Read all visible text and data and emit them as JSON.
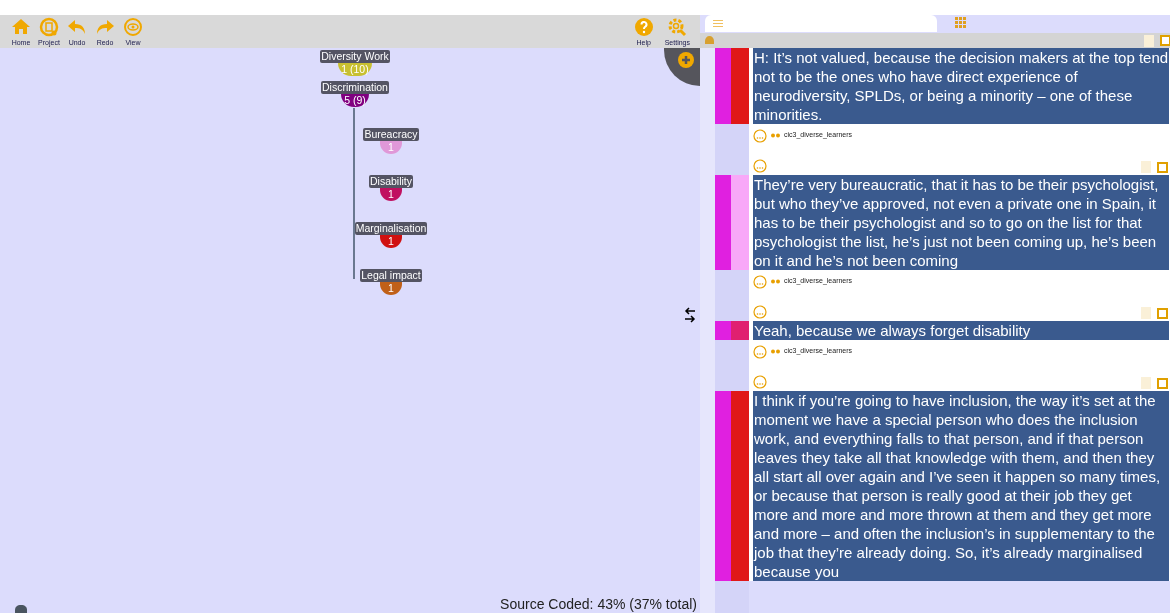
{
  "toolbar": {
    "left": [
      {
        "label": "Home"
      },
      {
        "label": "Project"
      },
      {
        "label": "Undo"
      },
      {
        "label": "Redo"
      },
      {
        "label": "View"
      }
    ],
    "right": [
      {
        "label": "Help"
      },
      {
        "label": "Settings"
      }
    ]
  },
  "tree": [
    {
      "label": "Diversity Work",
      "count": "1 (10)",
      "color": "#c8c030",
      "children": [
        {
          "label": "Discrimination",
          "count": "5 (9)",
          "color": "#800080",
          "children": [
            {
              "label": "Bureacracy",
              "count": "1",
              "color": "#e098d8"
            },
            {
              "label": "Disability",
              "count": "1",
              "color": "#c01060"
            },
            {
              "label": "Marginalisation",
              "count": "1",
              "color": "#d01010"
            },
            {
              "label": "Legal impact",
              "count": "1",
              "color": "#c06018"
            }
          ]
        }
      ]
    }
  ],
  "status": "Source Coded: 43% (37% total)",
  "segments": [
    {
      "text": "H: It’s not valued, because the decision makers at the top tend not to be the ones who have direct experience of neurodiversity, SPLDs, or being a minority – one of these minorities.",
      "codes": [
        {
          "color": "#e020e0"
        },
        {
          "color": "#e01818"
        }
      ],
      "source": "cic3_diverse_learners",
      "checked": false
    },
    {
      "text": "They’re very bureaucratic, that it has to be their psychologist, but who they’ve approved, not even a private one in Spain, it has to be their psychologist and so to go on the list for that psychologist the list, he’s just not been coming up, he’s been on it and he’s not been coming",
      "codes": [
        {
          "color": "#e020e0"
        },
        {
          "color": "#f8a8f8"
        }
      ],
      "source": "cic3_diverse_learners",
      "checked": false
    },
    {
      "text": "Yeah, because we always forget disability",
      "codes": [
        {
          "color": "#e020e0"
        },
        {
          "color": "#e02070"
        }
      ],
      "source": "cic3_diverse_learners",
      "checked": false
    },
    {
      "text": "I think if you’re going to have inclusion, the way it’s set at the moment we have a special person who does the inclusion work, and everything falls to that person, and if that person leaves they take all that knowledge with them, and then they all start all over again and I’ve seen it happen so many times, or because that person is really good at their job they get more and more and more thrown at them and they get more and more – and often the inclusion’s in supplementary to the job that they’re already doing. So, it’s already marginalised because you",
      "codes": [
        {
          "color": "#e020e0"
        },
        {
          "color": "#e01818"
        }
      ],
      "checked": false
    }
  ]
}
